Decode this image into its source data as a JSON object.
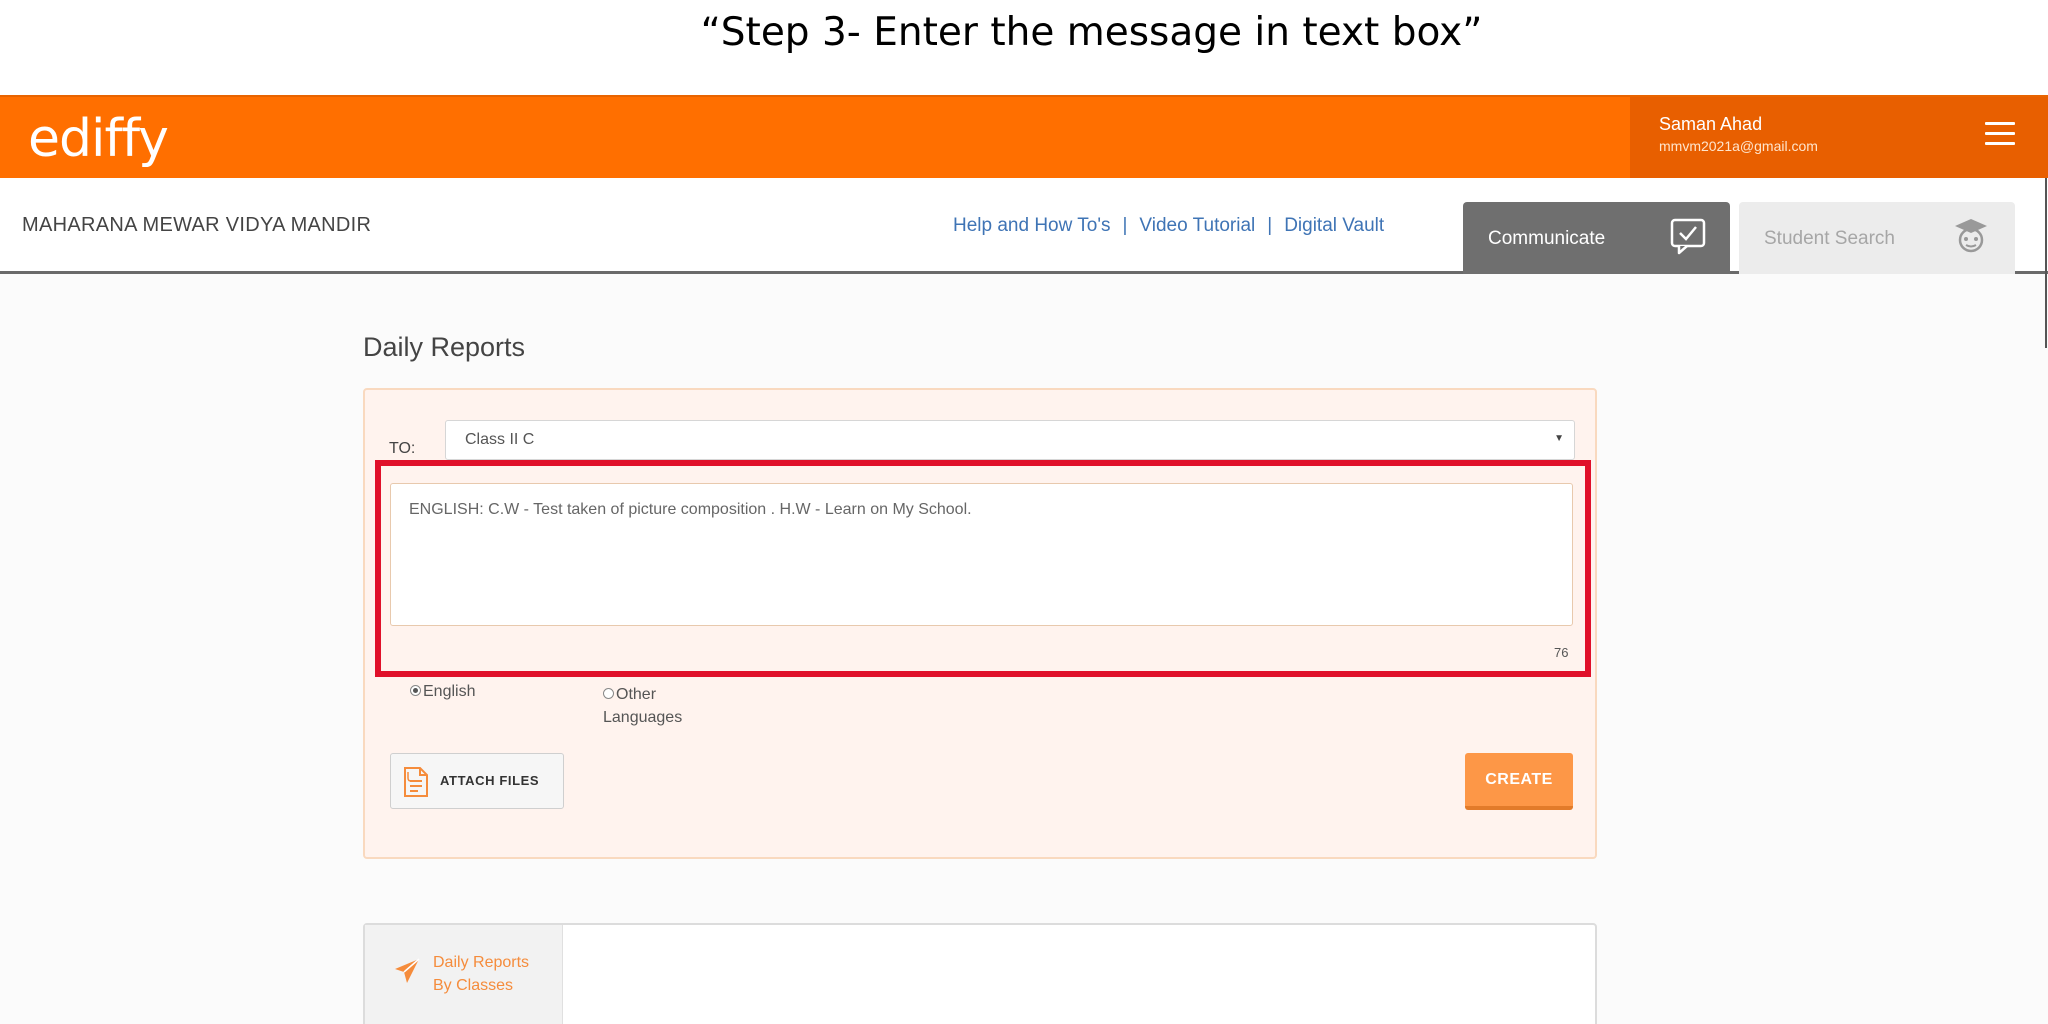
{
  "caption": "“Step 3- Enter the message in text box”",
  "header": {
    "logo": "ediffy",
    "user_name": "Saman Ahad",
    "user_email": "mmvm2021a@gmail.com",
    "brand_color": "#ff6f00"
  },
  "subheader": {
    "school": "MAHARANA MEWAR VIDYA MANDIR",
    "links": [
      "Help and How To's",
      "Video Tutorial",
      "Digital Vault"
    ],
    "separator": "|",
    "tabs": {
      "communicate": "Communicate",
      "student_search": "Student Search"
    }
  },
  "main": {
    "title": "Daily Reports",
    "form": {
      "to_label": "TO:",
      "to_value": "Class II C",
      "message": "ENGLISH: C.W - Test taken of picture composition . H.W - Learn on My School.",
      "char_count": "76",
      "language_english": "English",
      "language_other_1": "Other",
      "language_other_2": "Languages",
      "attach_label": "ATTACH FILES",
      "create_label": "CREATE"
    },
    "bottom_tab": {
      "line1": "Daily Reports",
      "line2": "By Classes"
    }
  }
}
